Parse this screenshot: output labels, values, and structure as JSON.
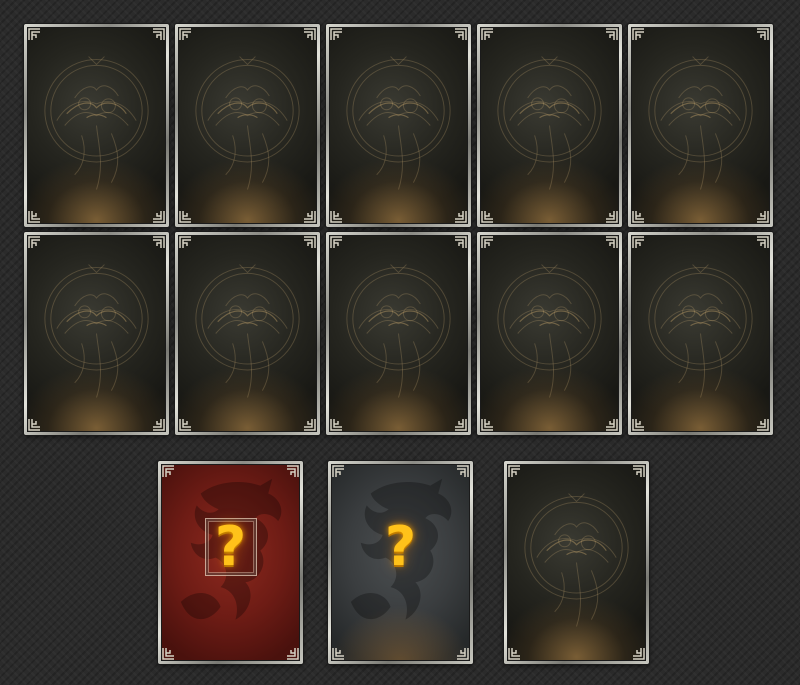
{
  "board": {
    "grid_rows": 2,
    "grid_columns": 5,
    "grid_cards": [
      {
        "state": "face-down"
      },
      {
        "state": "face-down"
      },
      {
        "state": "face-down"
      },
      {
        "state": "face-down"
      },
      {
        "state": "face-down"
      },
      {
        "state": "face-down"
      },
      {
        "state": "face-down"
      },
      {
        "state": "face-down"
      },
      {
        "state": "face-down"
      },
      {
        "state": "face-down"
      }
    ],
    "bottom_cards": [
      {
        "variant": "red",
        "icon": "question-mark-icon",
        "symbol": "?",
        "selected": true
      },
      {
        "variant": "grey",
        "icon": "question-mark-icon",
        "symbol": "?",
        "selected": false
      },
      {
        "variant": "back",
        "state": "face-down"
      }
    ]
  },
  "colors": {
    "background": "#2b2b2b",
    "frame_silver": "#c8c8c0",
    "card_back": "#25251f",
    "card_red": "#6e1c15",
    "card_grey": "#3a3d3f",
    "question_mark": "#ffc21a"
  }
}
